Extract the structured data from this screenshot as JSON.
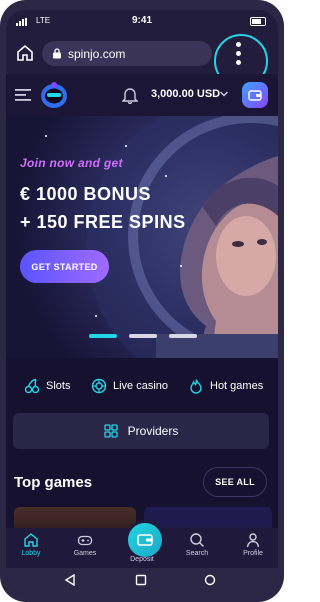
{
  "status_bar": {
    "network": "LTE",
    "time": "9:41"
  },
  "browser": {
    "url": "spinjo.com"
  },
  "header": {
    "balance": "3,000.00 USD"
  },
  "banner": {
    "tagline": "Join now and get",
    "bonus_line1": "€ 1000 BONUS",
    "bonus_line2": "+ 150 FREE SPINS",
    "cta": "GET STARTED",
    "active_slide": 1,
    "slides": 3
  },
  "categories": [
    {
      "label": "Slots",
      "icon": "cherry-icon"
    },
    {
      "label": "Live casino",
      "icon": "roulette-icon"
    },
    {
      "label": "Hot games",
      "icon": "flame-icon"
    }
  ],
  "providers": {
    "label": "Providers",
    "icon": "grid-icon"
  },
  "top_games": {
    "title": "Top games",
    "see_all": "SEE ALL"
  },
  "bottom_nav": [
    {
      "label": "Lobby",
      "icon": "home-icon",
      "active": true
    },
    {
      "label": "Games",
      "icon": "gamepad-icon"
    },
    {
      "label": "Deposit",
      "icon": "wallet-icon"
    },
    {
      "label": "Search",
      "icon": "search-icon"
    },
    {
      "label": "Profile",
      "icon": "user-icon"
    }
  ],
  "colors": {
    "accent": "#23d6e6",
    "purple": "#a06bff",
    "background": "#16112e"
  }
}
